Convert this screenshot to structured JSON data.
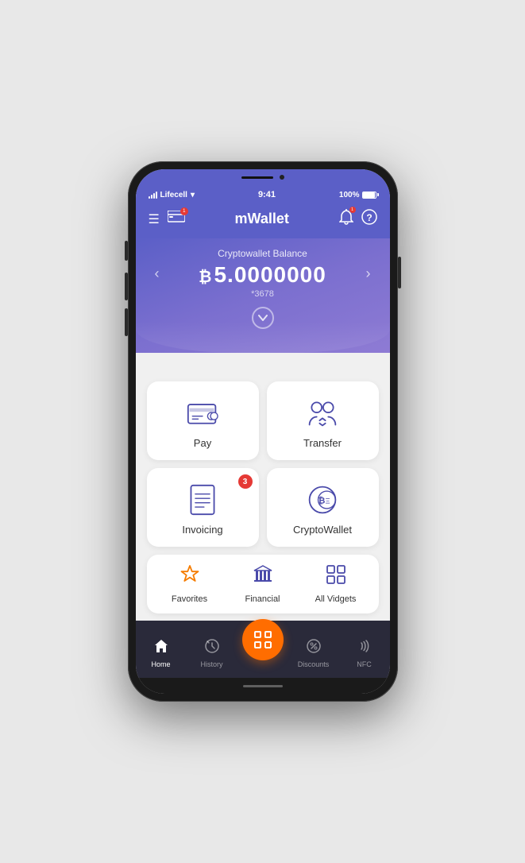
{
  "status_bar": {
    "carrier": "Lifecell",
    "time": "9:41",
    "battery": "100%"
  },
  "top_nav": {
    "title": "mWallet",
    "card_badge": "1"
  },
  "balance": {
    "label": "Cryptowallet Balance",
    "symbol": "₿",
    "amount": "5.0000000",
    "account": "*3678",
    "left_arrow": "‹",
    "right_arrow": "›"
  },
  "actions": [
    {
      "id": "pay",
      "label": "Pay",
      "badge": null
    },
    {
      "id": "transfer",
      "label": "Transfer",
      "badge": null
    },
    {
      "id": "invoicing",
      "label": "Invoicing",
      "badge": "3"
    },
    {
      "id": "cryptowallet",
      "label": "CryptoWallet",
      "badge": null
    }
  ],
  "widgets": [
    {
      "id": "favorites",
      "label": "Favorites",
      "icon_type": "star",
      "color": "orange"
    },
    {
      "id": "financial",
      "label": "Financial",
      "icon_type": "bank",
      "color": "purple"
    },
    {
      "id": "all-vidgets",
      "label": "All Vidgets",
      "icon_type": "grid",
      "color": "purple"
    }
  ],
  "bottom_nav": [
    {
      "id": "home",
      "label": "Home",
      "active": true
    },
    {
      "id": "history",
      "label": "History",
      "active": false
    },
    {
      "id": "scan",
      "label": "",
      "is_scan": true
    },
    {
      "id": "discounts",
      "label": "Discounts",
      "active": false
    },
    {
      "id": "nfc",
      "label": "NFC",
      "active": false
    }
  ]
}
